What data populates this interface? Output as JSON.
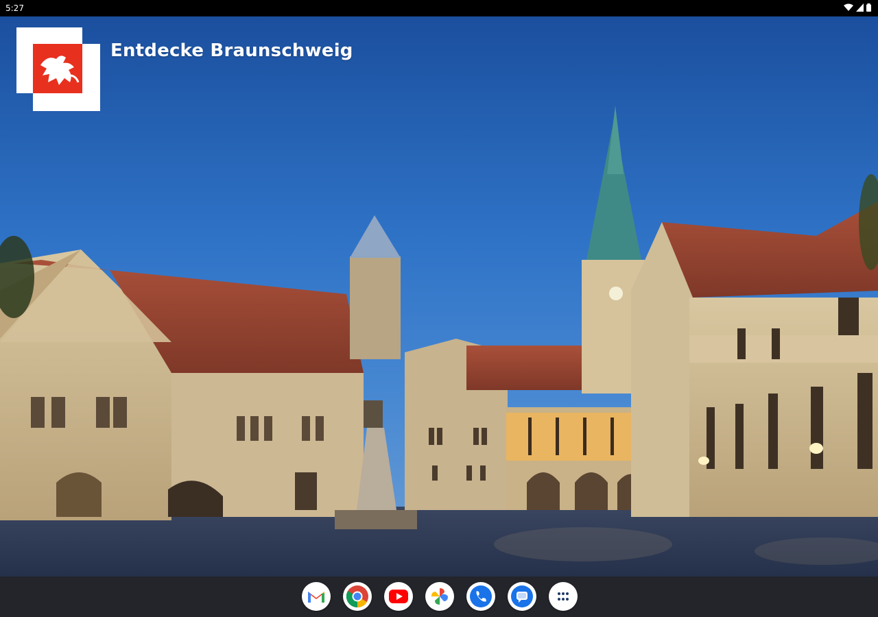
{
  "status_bar": {
    "time": "5:27",
    "icons": [
      "wifi-icon",
      "signal-icon",
      "battery-icon"
    ]
  },
  "app": {
    "title": "Entdecke Braunschweig",
    "logo": "braunschweig-lion-logo",
    "brand_color": "#e8301f"
  },
  "dock": {
    "apps": [
      {
        "name": "Gmail",
        "icon": "gmail-icon"
      },
      {
        "name": "Chrome",
        "icon": "chrome-icon"
      },
      {
        "name": "YouTube",
        "icon": "youtube-icon"
      },
      {
        "name": "Photos",
        "icon": "photos-icon"
      },
      {
        "name": "Phone",
        "icon": "phone-icon"
      },
      {
        "name": "Messages",
        "icon": "messages-icon"
      },
      {
        "name": "App drawer",
        "icon": "app-drawer-icon"
      }
    ]
  }
}
